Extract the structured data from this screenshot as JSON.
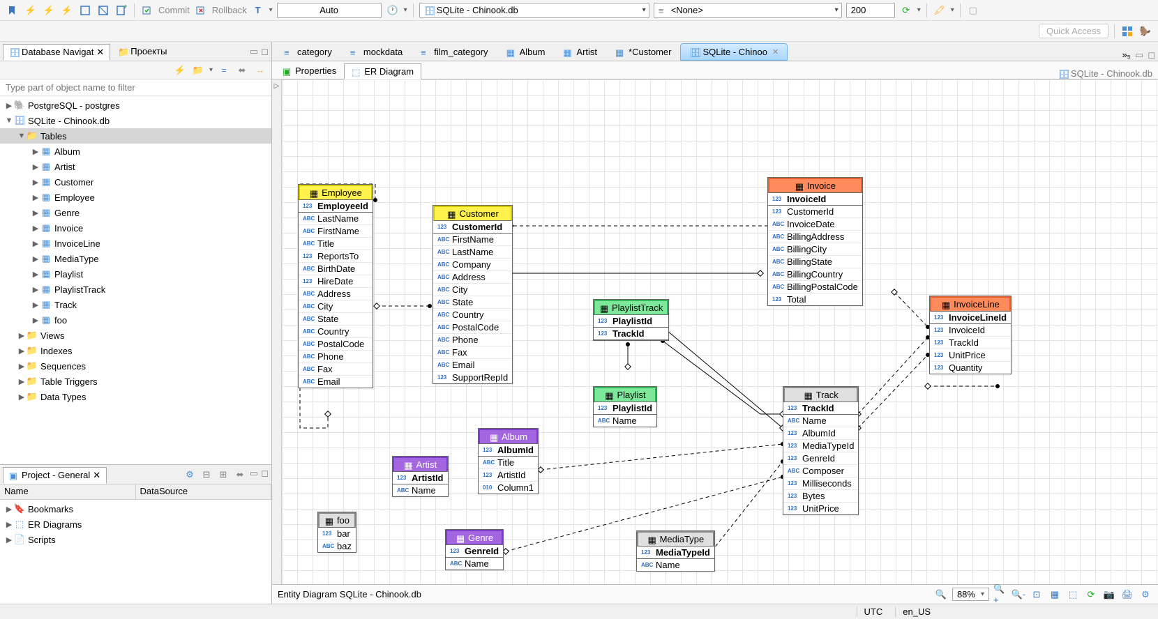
{
  "toolbar": {
    "commit": "Commit",
    "rollback": "Rollback",
    "txmode": "Auto",
    "conn1": "SQLite - Chinook.db",
    "conn2": "<None>",
    "limit": "200"
  },
  "quick_access": "Quick Access",
  "nav": {
    "tab1": "Database Navigat",
    "tab2": "Проекты",
    "filter_ph": "Type part of object name to filter",
    "tree": {
      "pg": "PostgreSQL - postgres",
      "sqlite": "SQLite - Chinook.db",
      "tables": "Tables",
      "items": [
        "Album",
        "Artist",
        "Customer",
        "Employee",
        "Genre",
        "Invoice",
        "InvoiceLine",
        "MediaType",
        "Playlist",
        "PlaylistTrack",
        "Track",
        "foo"
      ],
      "views": "Views",
      "indexes": "Indexes",
      "sequences": "Sequences",
      "triggers": "Table Triggers",
      "datatypes": "Data Types"
    }
  },
  "project": {
    "title": "Project - General",
    "col1": "Name",
    "col2": "DataSource",
    "items": [
      "Bookmarks",
      "ER Diagrams",
      "Scripts"
    ]
  },
  "editor": {
    "tabs": [
      "category",
      "mockdata",
      "film_category",
      "Album",
      "Artist",
      "*Customer",
      "SQLite - Chinoo"
    ],
    "more": "»₅",
    "sub": {
      "props": "Properties",
      "erd": "ER Diagram"
    },
    "breadcrumb": "SQLite - Chinook.db"
  },
  "erd": {
    "entities": {
      "Employee": {
        "hdr": "Employee",
        "cols": [
          [
            "123",
            "EmployeeId",
            true
          ],
          [
            "ABC",
            "LastName"
          ],
          [
            "ABC",
            "FirstName"
          ],
          [
            "ABC",
            "Title"
          ],
          [
            "123",
            "ReportsTo"
          ],
          [
            "ABC",
            "BirthDate"
          ],
          [
            "123",
            "HireDate"
          ],
          [
            "ABC",
            "Address"
          ],
          [
            "ABC",
            "City"
          ],
          [
            "ABC",
            "State"
          ],
          [
            "ABC",
            "Country"
          ],
          [
            "ABC",
            "PostalCode"
          ],
          [
            "ABC",
            "Phone"
          ],
          [
            "ABC",
            "Fax"
          ],
          [
            "ABC",
            "Email"
          ]
        ]
      },
      "Customer": {
        "hdr": "Customer",
        "cols": [
          [
            "123",
            "CustomerId",
            true
          ],
          [
            "ABC",
            "FirstName"
          ],
          [
            "ABC",
            "LastName"
          ],
          [
            "ABC",
            "Company"
          ],
          [
            "ABC",
            "Address"
          ],
          [
            "ABC",
            "City"
          ],
          [
            "ABC",
            "State"
          ],
          [
            "ABC",
            "Country"
          ],
          [
            "ABC",
            "PostalCode"
          ],
          [
            "ABC",
            "Phone"
          ],
          [
            "ABC",
            "Fax"
          ],
          [
            "ABC",
            "Email"
          ],
          [
            "123",
            "SupportRepId"
          ]
        ]
      },
      "Invoice": {
        "hdr": "Invoice",
        "cols": [
          [
            "123",
            "InvoiceId",
            true
          ],
          [
            "123",
            "CustomerId"
          ],
          [
            "ABC",
            "InvoiceDate"
          ],
          [
            "ABC",
            "BillingAddress"
          ],
          [
            "ABC",
            "BillingCity"
          ],
          [
            "ABC",
            "BillingState"
          ],
          [
            "ABC",
            "BillingCountry"
          ],
          [
            "ABC",
            "BillingPostalCode"
          ],
          [
            "123",
            "Total"
          ]
        ]
      },
      "InvoiceLine": {
        "hdr": "InvoiceLine",
        "cols": [
          [
            "123",
            "InvoiceLineId",
            true
          ],
          [
            "123",
            "InvoiceId"
          ],
          [
            "123",
            "TrackId"
          ],
          [
            "123",
            "UnitPrice"
          ],
          [
            "123",
            "Quantity"
          ]
        ]
      },
      "PlaylistTrack": {
        "hdr": "PlaylistTrack",
        "cols": [
          [
            "123",
            "PlaylistId",
            true
          ],
          [
            "123",
            "TrackId",
            true
          ]
        ]
      },
      "Playlist": {
        "hdr": "Playlist",
        "cols": [
          [
            "123",
            "PlaylistId",
            true
          ],
          [
            "ABC",
            "Name"
          ]
        ]
      },
      "Track": {
        "hdr": "Track",
        "cols": [
          [
            "123",
            "TrackId",
            true
          ],
          [
            "ABC",
            "Name"
          ],
          [
            "123",
            "AlbumId"
          ],
          [
            "123",
            "MediaTypeId"
          ],
          [
            "123",
            "GenreId"
          ],
          [
            "ABC",
            "Composer"
          ],
          [
            "123",
            "Milliseconds"
          ],
          [
            "123",
            "Bytes"
          ],
          [
            "123",
            "UnitPrice"
          ]
        ]
      },
      "Artist": {
        "hdr": "Artist",
        "cols": [
          [
            "123",
            "ArtistId",
            true
          ],
          [
            "ABC",
            "Name"
          ]
        ]
      },
      "Album": {
        "hdr": "Album",
        "cols": [
          [
            "123",
            "AlbumId",
            true
          ],
          [
            "ABC",
            "Title"
          ],
          [
            "123",
            "ArtistId"
          ],
          [
            "010",
            "Column1"
          ]
        ]
      },
      "Genre": {
        "hdr": "Genre",
        "cols": [
          [
            "123",
            "GenreId",
            true
          ],
          [
            "ABC",
            "Name"
          ]
        ]
      },
      "MediaType": {
        "hdr": "MediaType",
        "cols": [
          [
            "123",
            "MediaTypeId",
            true
          ],
          [
            "ABC",
            "Name"
          ]
        ]
      },
      "foo": {
        "hdr": "foo",
        "cols": [
          [
            "123",
            "bar"
          ],
          [
            "ABC",
            "baz"
          ]
        ]
      }
    },
    "footer": "Entity Diagram SQLite - Chinook.db",
    "zoom": "88%"
  },
  "status": {
    "tz": "UTC",
    "locale": "en_US"
  }
}
